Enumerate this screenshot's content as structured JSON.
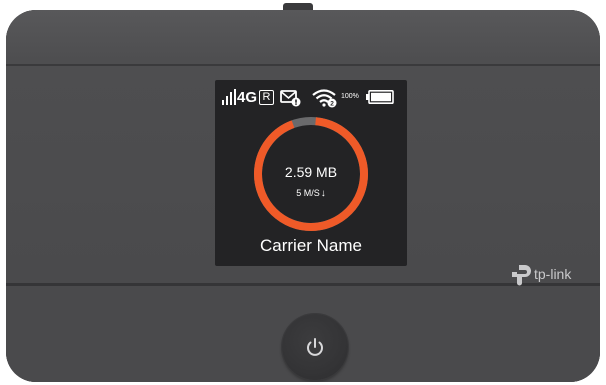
{
  "device": {
    "brand": "tp-link",
    "colors": {
      "body": "#4a4a4c",
      "screen": "#232325",
      "ring_accent": "#ef5a28",
      "ring_track": "#6a6a6c"
    }
  },
  "status_bar": {
    "signal_icon": "signal-bars-icon",
    "network_type": "4G",
    "roaming_indicator": "R",
    "message_icon": "message-icon",
    "wifi_icon": "wifi-icon",
    "battery_level": "100%",
    "battery_icon": "battery-full-icon"
  },
  "usage": {
    "data_used": "2.59 MB",
    "speed": "5 M/S",
    "speed_direction_icon": "arrow-down-icon",
    "ring_fraction": 0.93
  },
  "carrier": {
    "name": "Carrier Name"
  },
  "controls": {
    "power_icon": "power-icon"
  }
}
